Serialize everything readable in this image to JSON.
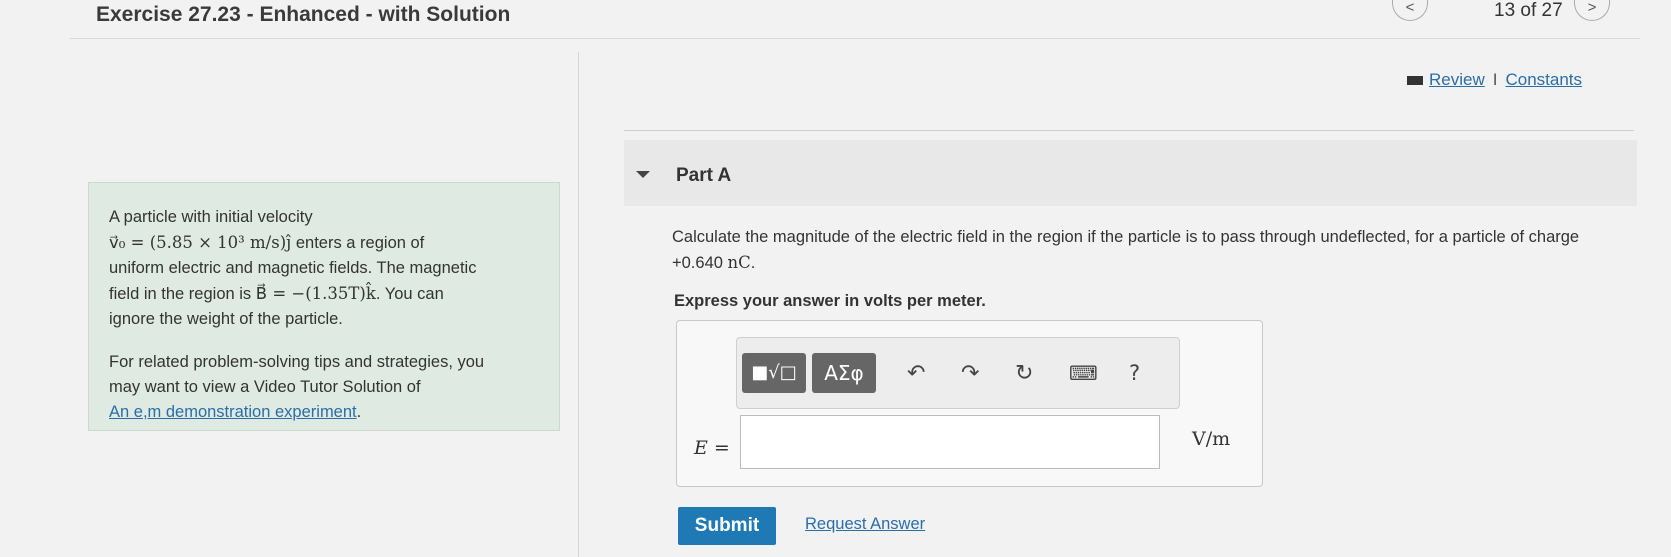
{
  "header": {
    "title": "Exercise 27.23 - Enhanced - with Solution",
    "prev_label": "<",
    "next_label": ">",
    "page_count": "13 of 27"
  },
  "links": {
    "review": "Review",
    "separator": "I",
    "constants": "Constants"
  },
  "part": {
    "title": "Part A"
  },
  "problem": {
    "line1": "A particle with initial velocity",
    "v0_expr": "v⃗₀ = (5.85 × 10³ m/s)ĵ",
    "line2_rest": " enters a region of",
    "line3": "uniform electric and magnetic fields. The magnetic",
    "line4_start": "field in the region is ",
    "b_expr": "B⃗ = −(1.35T)k̂",
    "line4_rest": ". You can",
    "line5": "ignore the weight of the particle.",
    "tips_line1": "For related problem-solving tips and strategies, you",
    "tips_line2": "may want to view a Video Tutor Solution of",
    "tips_link": "An e,m demonstration experiment",
    "tips_end": "."
  },
  "question": {
    "text": "Calculate the magnitude of the electric field in the region if the particle is to pass through undeflected, for a particle of charge +0.640 ",
    "unit": "nC",
    "end": ".",
    "instruction": "Express your answer in volts per meter."
  },
  "toolbar": {
    "templates_icon": "■√□",
    "greek": "ΑΣφ",
    "undo": "↶",
    "redo": "↷",
    "reset": "↻",
    "keyboard": "⌨",
    "help": "?"
  },
  "answer": {
    "label": "E =",
    "value": "",
    "unit": "V/m"
  },
  "buttons": {
    "submit": "Submit",
    "request": "Request Answer"
  }
}
